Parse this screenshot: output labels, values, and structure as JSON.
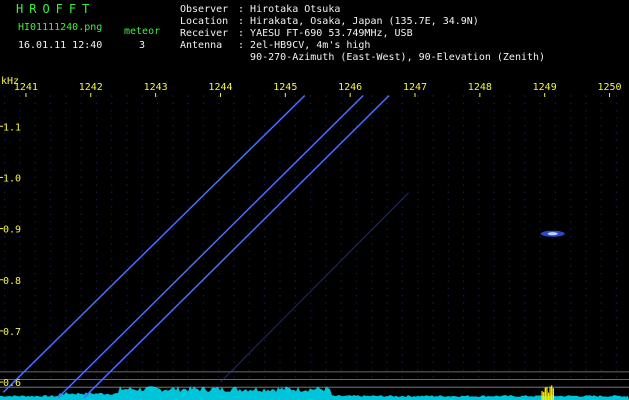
{
  "header": {
    "logo": "HROFFT",
    "filename": "HI01111240.png",
    "meteor_label": "meteor",
    "datetime": "16.01.11 12:40",
    "meteor_count": "3",
    "info": [
      {
        "key": "Observer",
        "value": "Hirotaka Otsuka"
      },
      {
        "key": "Location",
        "value": "Hirakata, Osaka, Japan (135.7E, 34.9N)"
      },
      {
        "key": "Receiver",
        "value": "YAESU FT-690 53.749MHz, USB"
      },
      {
        "key": "Antenna",
        "value": "2el-HB9CV, 4m's high"
      },
      {
        "key": "",
        "value": "90-270-Azimuth (East-West), 90-Elevation (Zenith)"
      }
    ]
  },
  "colors": {
    "background": "#000000",
    "header_green": "#3df03d",
    "header_white": "#f2f2f2",
    "axis_yellow": "#f5f542",
    "trace_blue": "#3a5cff",
    "noise_cyan": "#00e6ff",
    "burst_yellow": "#ffee00"
  },
  "chart_data": {
    "type": "spectrogram",
    "x_axis_label": "",
    "y_axis_label": "kHz",
    "x_ticks": [
      "1241",
      "1242",
      "1243",
      "1244",
      "1245",
      "1246",
      "1247",
      "1248",
      "1249",
      "1250"
    ],
    "y_ticks": [
      "1.1",
      "1.0",
      "0.9",
      "0.8",
      "0.7",
      "0.6"
    ],
    "xlim": [
      1240.6,
      1250.3
    ],
    "ylim": [
      0.565,
      1.165
    ],
    "reference_lines_khz": [
      0.62,
      0.605,
      0.59
    ],
    "meteor_traces": [
      {
        "start": [
          1240.65,
          0.58
        ],
        "end": [
          1245.3,
          1.16
        ]
      },
      {
        "start": [
          1241.5,
          0.57
        ],
        "end": [
          1246.2,
          1.16
        ]
      },
      {
        "start": [
          1241.9,
          0.57
        ],
        "end": [
          1246.6,
          1.16
        ]
      }
    ],
    "faint_traces": [
      {
        "start": [
          1244.0,
          0.6
        ],
        "end": [
          1246.9,
          0.97
        ]
      }
    ],
    "echo_blob": {
      "x": 1249.0,
      "y": 0.89
    },
    "noise_band_khz": [
      0.565,
      0.59
    ],
    "burst_x": 1248.95
  }
}
